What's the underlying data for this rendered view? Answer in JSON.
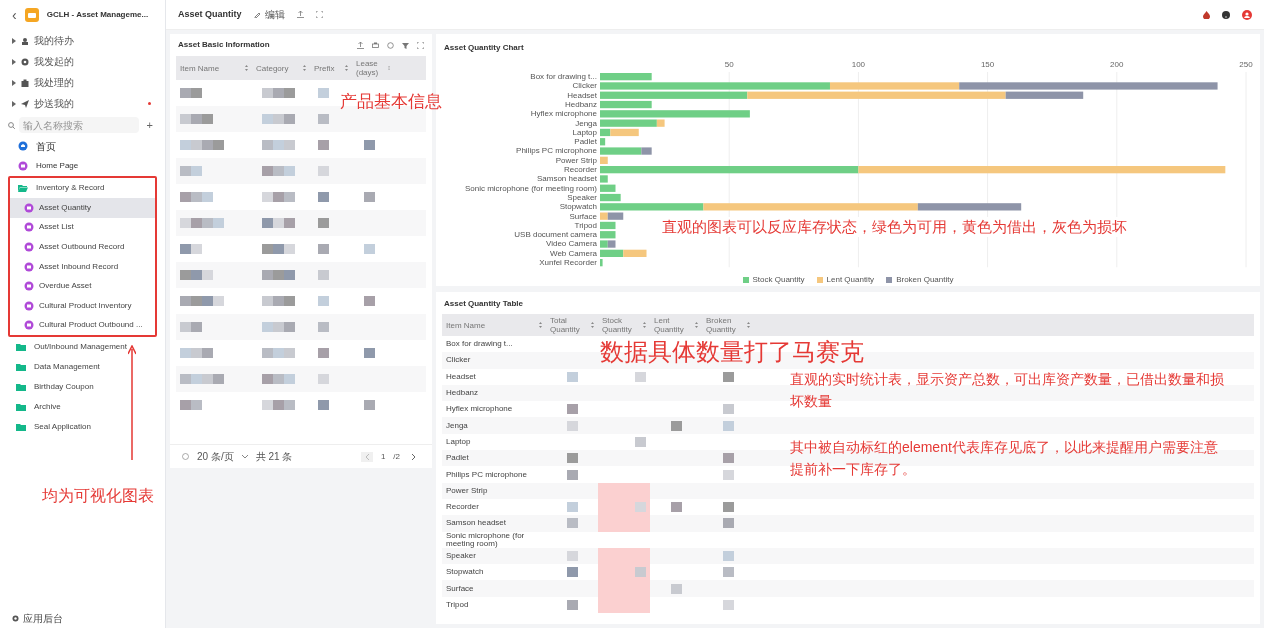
{
  "app": {
    "title": "GCLH - Asset Manageme...",
    "back": "‹"
  },
  "sidebar": {
    "todo_items": [
      {
        "label": "我的待办",
        "badge": false
      },
      {
        "label": "我发起的",
        "badge": false
      },
      {
        "label": "我处理的",
        "badge": false
      },
      {
        "label": "抄送我的",
        "badge": true
      }
    ],
    "search": {
      "placeholder": "输入名称搜索",
      "add": "+"
    },
    "pages": [
      {
        "label": "首页",
        "kind": "home"
      },
      {
        "label": "Home Page",
        "kind": "page"
      }
    ],
    "groups": [
      {
        "label": "Inventory & Record",
        "expanded": true,
        "annotated": true,
        "children": [
          {
            "label": "Asset Quantity",
            "selected": true
          },
          {
            "label": "Asset List",
            "selected": false
          },
          {
            "label": "Asset Outbound Record",
            "selected": false
          },
          {
            "label": "Asset Inbound Record",
            "selected": false
          },
          {
            "label": "Overdue Asset",
            "selected": false
          },
          {
            "label": "Cultural Product Inventory",
            "selected": false
          },
          {
            "label": "Cultural Product Outbound ...",
            "selected": false
          }
        ]
      },
      {
        "label": "Out/Inbound Management",
        "expanded": false
      },
      {
        "label": "Data Management",
        "expanded": false
      },
      {
        "label": "Birthday Coupon",
        "expanded": false
      },
      {
        "label": "Archive",
        "expanded": false
      },
      {
        "label": "Seal Application",
        "expanded": false
      }
    ],
    "footer": "应用后台"
  },
  "topbar": {
    "title": "Asset Quantity",
    "edit": "编辑"
  },
  "basic_info": {
    "title": "Asset Basic Information",
    "columns": [
      "Item Name",
      "Category",
      "Prefix",
      "Lease (days)"
    ],
    "rows": [
      {
        "kind": "pixelated"
      },
      {
        "kind": "pixelated"
      },
      {
        "kind": "pixelated"
      },
      {
        "kind": "pixelated"
      },
      {
        "kind": "pixelated"
      },
      {
        "kind": "pixelated"
      },
      {
        "kind": "pixelated"
      },
      {
        "kind": "pixelated"
      },
      {
        "kind": "pixelated"
      },
      {
        "kind": "pixelated"
      },
      {
        "kind": "pixelated"
      },
      {
        "kind": "pixelated"
      },
      {
        "kind": "pixelated"
      }
    ],
    "page_size": "20 条/页",
    "total": "共 21 条",
    "page": "1",
    "pages": "/2"
  },
  "chart": {
    "title": "Asset Quantity Chart",
    "chart_data": {
      "type": "bar",
      "orientation": "horizontal",
      "stacked": true,
      "grid": true,
      "xlim": [
        0,
        250
      ],
      "xticks": [
        50,
        100,
        150,
        200,
        250
      ],
      "categories": [
        "Box for drawing t...",
        "Clicker",
        "Headset",
        "Hedbanz",
        "Hyflex microphone",
        "Jenga",
        "Laptop",
        "Padlet",
        "Philips PC microphone",
        "Power Strip",
        "Recorder",
        "Samson headset",
        "Sonic microphone (for meeting room)",
        "Speaker",
        "Stopwatch",
        "Surface",
        "Tripod",
        "USB document camera",
        "Video Camera",
        "Web Camera",
        "Xunfei Recorder"
      ],
      "series": [
        {
          "name": "Stock Quantity",
          "color": "#6fcf86",
          "values": [
            20,
            89,
            57,
            20,
            58,
            22,
            4,
            2,
            16,
            0,
            100,
            3,
            6,
            8,
            40,
            0,
            6,
            6,
            3,
            9,
            1
          ]
        },
        {
          "name": "Lent Quantity",
          "color": "#f5c77e",
          "values": [
            0,
            50,
            100,
            0,
            0,
            3,
            11,
            0,
            0,
            3,
            142,
            0,
            0,
            0,
            83,
            3,
            0,
            0,
            0,
            9,
            0
          ]
        },
        {
          "name": "Broken Quantity",
          "color": "#8e94a8",
          "values": [
            0,
            100,
            30,
            0,
            0,
            0,
            0,
            0,
            4,
            0,
            0,
            0,
            0,
            0,
            40,
            6,
            0,
            0,
            3,
            0,
            0
          ]
        }
      ]
    }
  },
  "quantity_table": {
    "title": "Asset Quantity Table",
    "columns": [
      "Item Name",
      "Total Quantity",
      "Stock Quantity",
      "Lent Quantity",
      "Broken Quantity"
    ],
    "rows": [
      {
        "item_name": "Box for drawing t...",
        "low_stock": false
      },
      {
        "item_name": "Clicker",
        "low_stock": false
      },
      {
        "item_name": "Headset",
        "low_stock": false
      },
      {
        "item_name": "Hedbanz",
        "low_stock": false
      },
      {
        "item_name": "Hyflex microphone",
        "low_stock": false
      },
      {
        "item_name": "Jenga",
        "low_stock": false
      },
      {
        "item_name": "Laptop",
        "low_stock": false
      },
      {
        "item_name": "Padlet",
        "low_stock": false
      },
      {
        "item_name": "Philips PC microphone",
        "low_stock": false
      },
      {
        "item_name": "Power Strip",
        "low_stock": true
      },
      {
        "item_name": "Recorder",
        "low_stock": true
      },
      {
        "item_name": "Samson headset",
        "low_stock": true
      },
      {
        "item_name": "Sonic microphone (for meeting room)",
        "low_stock": false
      },
      {
        "item_name": "Speaker",
        "low_stock": true
      },
      {
        "item_name": "Stopwatch",
        "low_stock": true
      },
      {
        "item_name": "Surface",
        "low_stock": true
      },
      {
        "item_name": "Tripod",
        "low_stock": true
      }
    ]
  },
  "annotations": {
    "basic_info": "产品基本信息",
    "chart": "直观的图表可以反应库存状态，绿色为可用，黄色为借出，灰色为损坏",
    "mosaic": "数据具体数量打了马赛克",
    "table_1": "直观的实时统计表，显示资产总数，可出库资产数量，已借出数量和损坏数量",
    "table_2": "其中被自动标红的element代表库存见底了，以此来提醒用户需要注意提前补一下库存了。",
    "sidebar": "均为可视化图表"
  }
}
